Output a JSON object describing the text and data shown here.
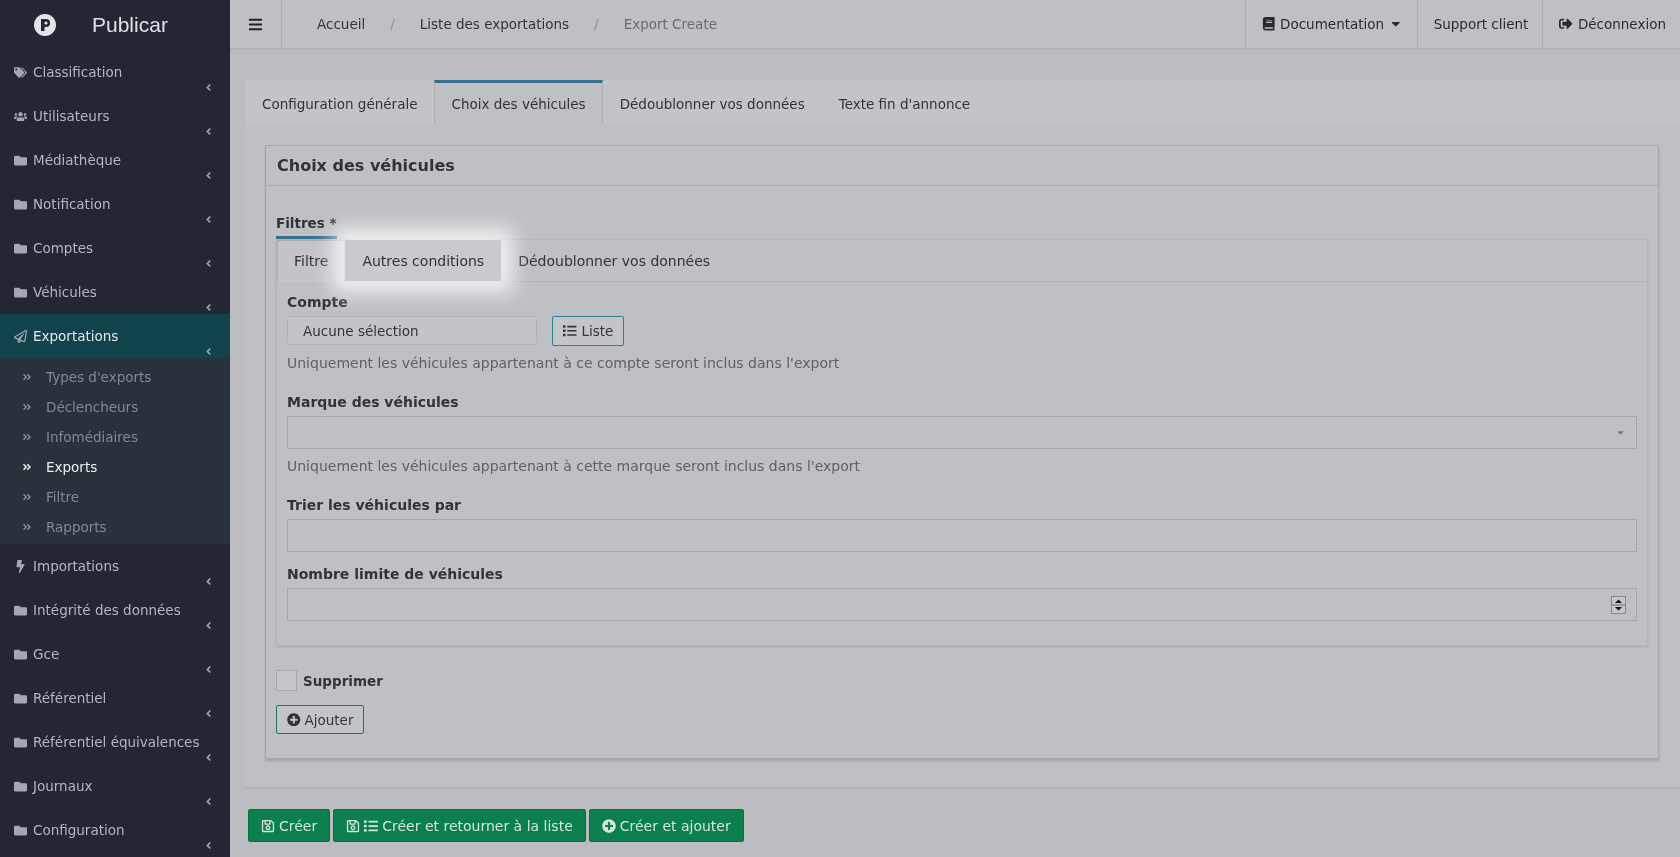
{
  "brand": {
    "name": "Publicar"
  },
  "sidebar": {
    "items": [
      {
        "label": "Classification",
        "selected": false
      },
      {
        "label": "Utilisateurs",
        "selected": false
      },
      {
        "label": "Médiathèque",
        "selected": false
      },
      {
        "label": "Notification",
        "selected": false
      },
      {
        "label": "Comptes",
        "selected": false
      },
      {
        "label": "Véhicules",
        "selected": false
      },
      {
        "label": "Exportations",
        "selected": true,
        "expanded": true,
        "children": [
          {
            "label": "Types d'exports",
            "selected": false
          },
          {
            "label": "Déclencheurs",
            "selected": false
          },
          {
            "label": "Infomédiaires",
            "selected": false
          },
          {
            "label": "Exports",
            "selected": true
          },
          {
            "label": "Filtre",
            "selected": false
          },
          {
            "label": "Rapports",
            "selected": false
          }
        ]
      },
      {
        "label": "Importations",
        "selected": false
      },
      {
        "label": "Intégrité des données",
        "selected": false
      },
      {
        "label": "Gce",
        "selected": false
      },
      {
        "label": "Référentiel",
        "selected": false
      },
      {
        "label": "Référentiel équivalences",
        "selected": false
      },
      {
        "label": "Journaux",
        "selected": false
      },
      {
        "label": "Configuration",
        "selected": false
      }
    ]
  },
  "topbar": {
    "breadcrumbs": [
      {
        "label": "Accueil",
        "current": false,
        "separator": "/"
      },
      {
        "label": "Liste des exportations",
        "current": false,
        "separator": "/"
      },
      {
        "label": "Export Create",
        "current": true
      }
    ],
    "links": [
      {
        "label": "Documentation",
        "kind": "dropdown"
      },
      {
        "label": "Support client",
        "kind": "plain"
      },
      {
        "label": "Déconnexion",
        "kind": "logout"
      }
    ]
  },
  "tabs": [
    {
      "label": "Configuration générale",
      "selected": false
    },
    {
      "label": "Choix des véhicules",
      "selected": true
    },
    {
      "label": "Dédoublonner vos données",
      "selected": false
    },
    {
      "label": "Texte fin d'annonce",
      "selected": false
    }
  ],
  "panel": {
    "title": "Choix des véhicules",
    "filters": {
      "label": "Filtres *",
      "tabs": [
        {
          "label": "Filtre",
          "selected": true,
          "highlighted": false
        },
        {
          "label": "Autres conditions",
          "selected": false,
          "highlighted": true
        },
        {
          "label": "Dédoublonner vos données",
          "selected": false,
          "highlighted": false
        }
      ]
    },
    "fields": [
      {
        "kind": "picker",
        "label": "Compte",
        "value": "Aucune sélection",
        "button": "Liste",
        "help": "Uniquement les véhicules appartenant à ce compte seront inclus dans l'export"
      },
      {
        "kind": "select",
        "label": "Marque des véhicules",
        "help": "Uniquement les véhicules appartenant à cette marque seront inclus dans l'export"
      },
      {
        "kind": "text",
        "label": "Trier les véhicules par"
      },
      {
        "kind": "number",
        "label": "Nombre limite de véhicules"
      }
    ],
    "delete": {
      "label": "Supprimer",
      "checked": false
    },
    "add_button": "Ajouter"
  },
  "actions": [
    {
      "label": "Créer",
      "kind": "save"
    },
    {
      "label": "Créer et retourner à la liste",
      "kind": "save-list"
    },
    {
      "label": "Créer et ajouter",
      "kind": "add"
    }
  ]
}
